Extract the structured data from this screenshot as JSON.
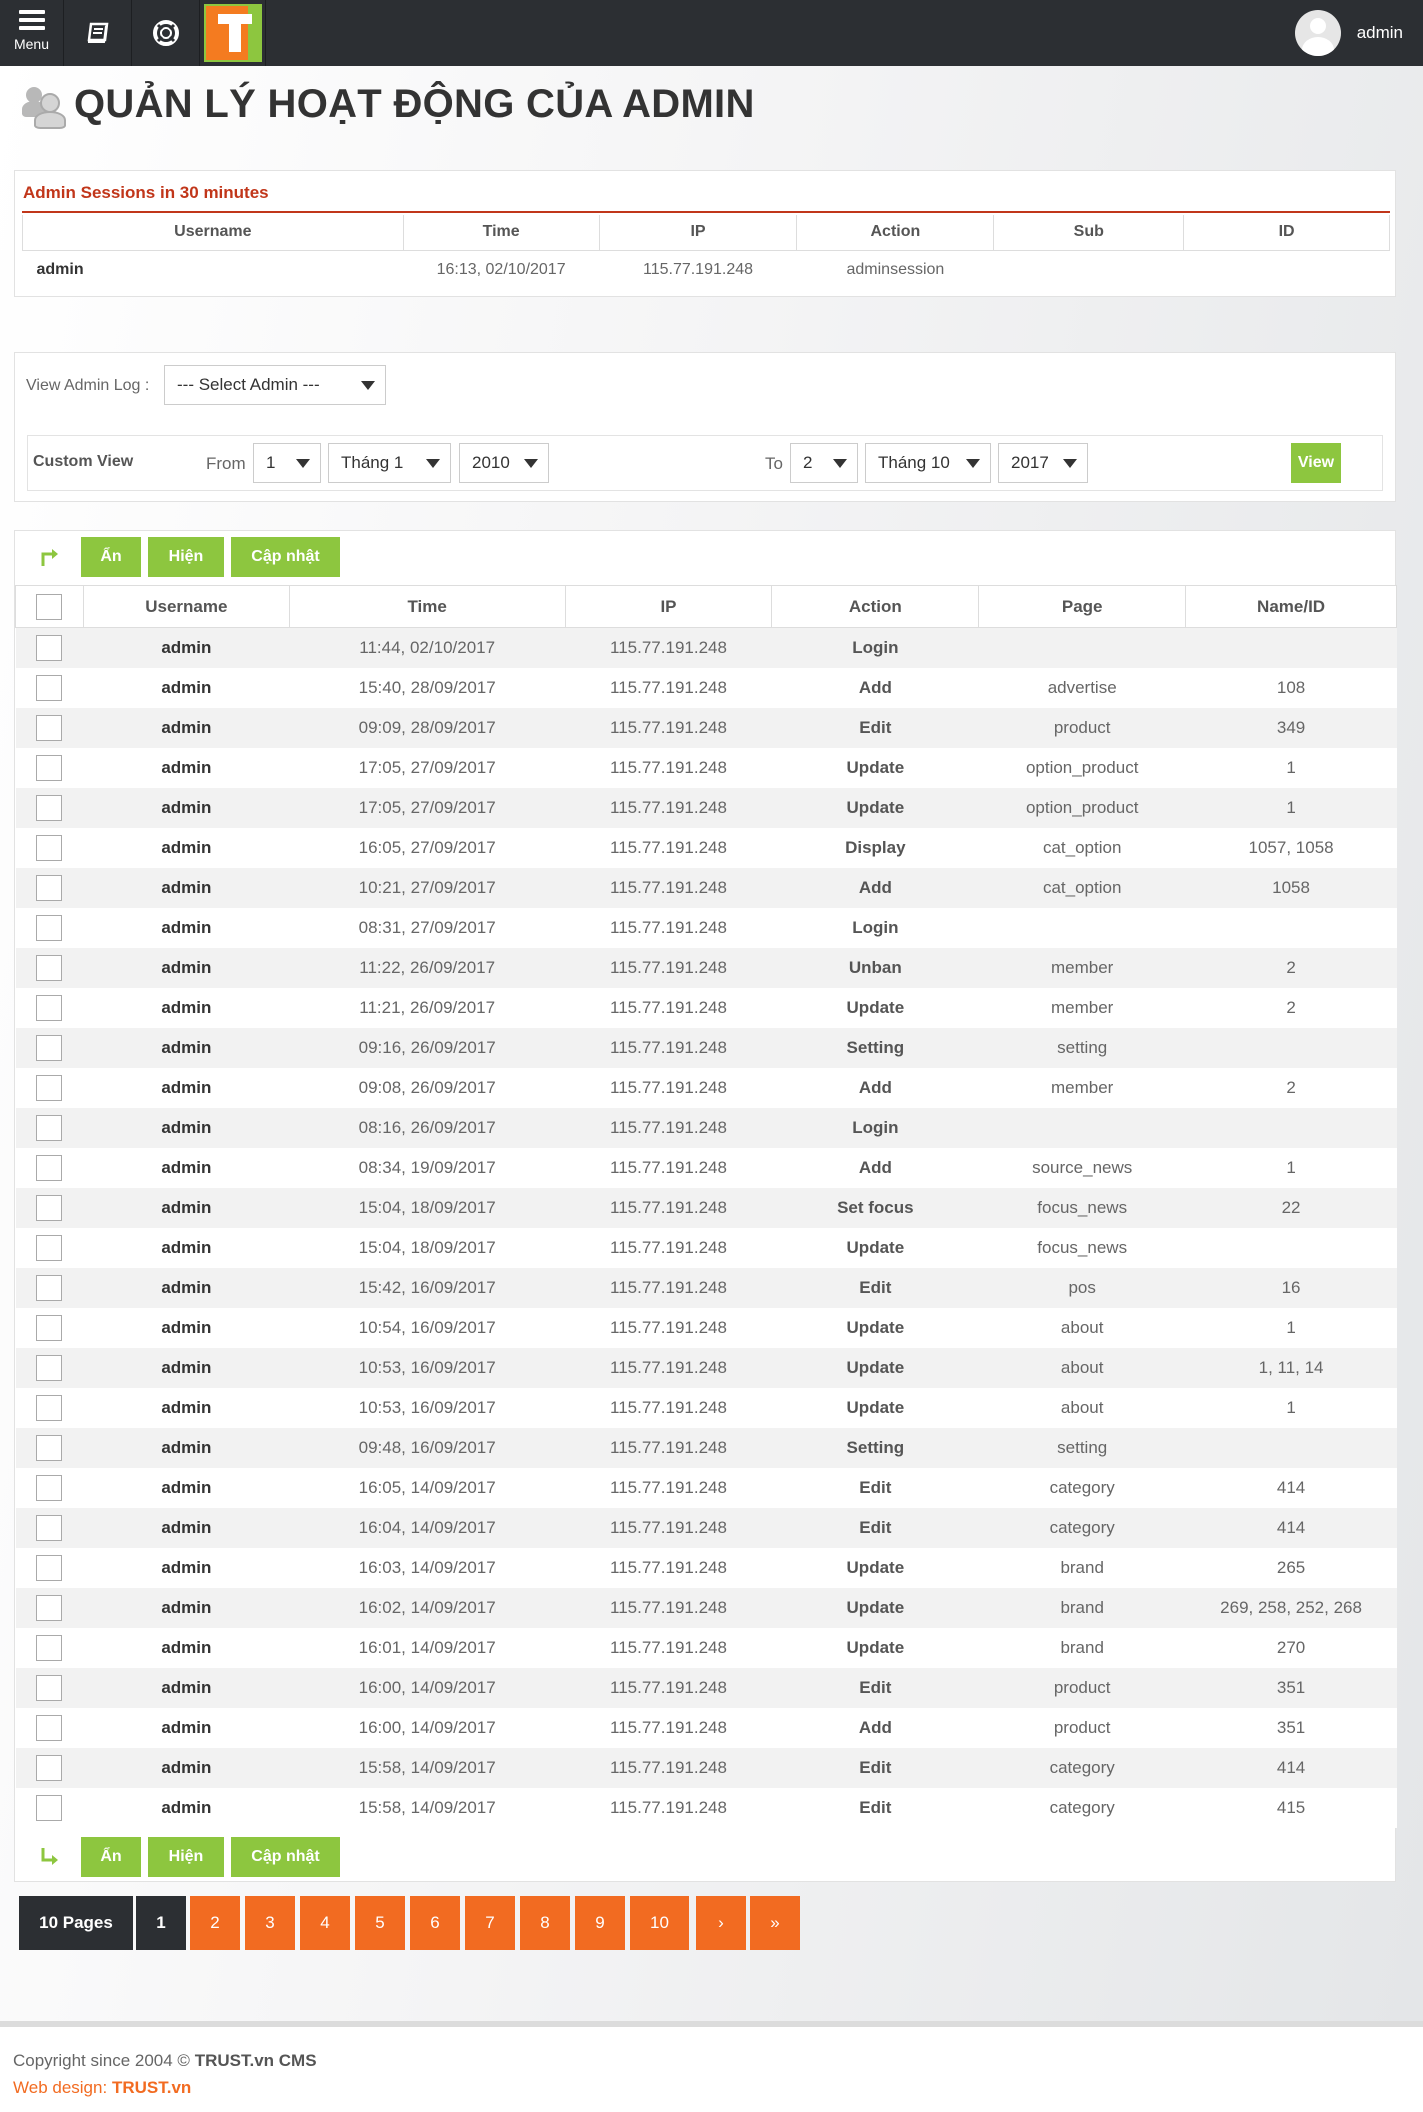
{
  "topbar": {
    "menu_label": "Menu",
    "user_name": "admin"
  },
  "page_title": "QUẢN LÝ HOẠT ĐỘNG CỦA ADMIN",
  "sessions": {
    "title": "Admin Sessions in 30 minutes",
    "headers": [
      "Username",
      "Time",
      "IP",
      "Action",
      "Sub",
      "ID"
    ],
    "rows": [
      {
        "username": "admin",
        "time": "16:13, 02/10/2017",
        "ip": "115.77.191.248",
        "action": "adminsession",
        "sub": "",
        "id": ""
      }
    ]
  },
  "filter": {
    "view_label": "View Admin Log :",
    "admin_select": "--- Select Admin ---",
    "custom_view_label": "Custom View",
    "from_label": "From",
    "from_day": "1",
    "from_month": "Tháng 1",
    "from_year": "2010",
    "to_label": "To",
    "to_day": "2",
    "to_month": "Tháng 10",
    "to_year": "2017",
    "view_button": "View"
  },
  "actions": {
    "hide": "Ẩn",
    "show": "Hiện",
    "update": "Cập nhật"
  },
  "log": {
    "headers": [
      "Username",
      "Time",
      "IP",
      "Action",
      "Page",
      "Name/ID"
    ],
    "rows": [
      {
        "username": "admin",
        "time": "11:44, 02/10/2017",
        "ip": "115.77.191.248",
        "action": "Login",
        "page": "",
        "nameid": ""
      },
      {
        "username": "admin",
        "time": "15:40, 28/09/2017",
        "ip": "115.77.191.248",
        "action": "Add",
        "page": "advertise",
        "nameid": "108"
      },
      {
        "username": "admin",
        "time": "09:09, 28/09/2017",
        "ip": "115.77.191.248",
        "action": "Edit",
        "page": "product",
        "nameid": "349"
      },
      {
        "username": "admin",
        "time": "17:05, 27/09/2017",
        "ip": "115.77.191.248",
        "action": "Update",
        "page": "option_product",
        "nameid": "1"
      },
      {
        "username": "admin",
        "time": "17:05, 27/09/2017",
        "ip": "115.77.191.248",
        "action": "Update",
        "page": "option_product",
        "nameid": "1"
      },
      {
        "username": "admin",
        "time": "16:05, 27/09/2017",
        "ip": "115.77.191.248",
        "action": "Display",
        "page": "cat_option",
        "nameid": "1057, 1058"
      },
      {
        "username": "admin",
        "time": "10:21, 27/09/2017",
        "ip": "115.77.191.248",
        "action": "Add",
        "page": "cat_option",
        "nameid": "1058"
      },
      {
        "username": "admin",
        "time": "08:31, 27/09/2017",
        "ip": "115.77.191.248",
        "action": "Login",
        "page": "",
        "nameid": ""
      },
      {
        "username": "admin",
        "time": "11:22, 26/09/2017",
        "ip": "115.77.191.248",
        "action": "Unban",
        "page": "member",
        "nameid": "2"
      },
      {
        "username": "admin",
        "time": "11:21, 26/09/2017",
        "ip": "115.77.191.248",
        "action": "Update",
        "page": "member",
        "nameid": "2"
      },
      {
        "username": "admin",
        "time": "09:16, 26/09/2017",
        "ip": "115.77.191.248",
        "action": "Setting",
        "page": "setting",
        "nameid": ""
      },
      {
        "username": "admin",
        "time": "09:08, 26/09/2017",
        "ip": "115.77.191.248",
        "action": "Add",
        "page": "member",
        "nameid": "2"
      },
      {
        "username": "admin",
        "time": "08:16, 26/09/2017",
        "ip": "115.77.191.248",
        "action": "Login",
        "page": "",
        "nameid": ""
      },
      {
        "username": "admin",
        "time": "08:34, 19/09/2017",
        "ip": "115.77.191.248",
        "action": "Add",
        "page": "source_news",
        "nameid": "1"
      },
      {
        "username": "admin",
        "time": "15:04, 18/09/2017",
        "ip": "115.77.191.248",
        "action": "Set focus",
        "page": "focus_news",
        "nameid": "22"
      },
      {
        "username": "admin",
        "time": "15:04, 18/09/2017",
        "ip": "115.77.191.248",
        "action": "Update",
        "page": "focus_news",
        "nameid": ""
      },
      {
        "username": "admin",
        "time": "15:42, 16/09/2017",
        "ip": "115.77.191.248",
        "action": "Edit",
        "page": "pos",
        "nameid": "16"
      },
      {
        "username": "admin",
        "time": "10:54, 16/09/2017",
        "ip": "115.77.191.248",
        "action": "Update",
        "page": "about",
        "nameid": "1"
      },
      {
        "username": "admin",
        "time": "10:53, 16/09/2017",
        "ip": "115.77.191.248",
        "action": "Update",
        "page": "about",
        "nameid": "1, 11, 14"
      },
      {
        "username": "admin",
        "time": "10:53, 16/09/2017",
        "ip": "115.77.191.248",
        "action": "Update",
        "page": "about",
        "nameid": "1"
      },
      {
        "username": "admin",
        "time": "09:48, 16/09/2017",
        "ip": "115.77.191.248",
        "action": "Setting",
        "page": "setting",
        "nameid": ""
      },
      {
        "username": "admin",
        "time": "16:05, 14/09/2017",
        "ip": "115.77.191.248",
        "action": "Edit",
        "page": "category",
        "nameid": "414"
      },
      {
        "username": "admin",
        "time": "16:04, 14/09/2017",
        "ip": "115.77.191.248",
        "action": "Edit",
        "page": "category",
        "nameid": "414"
      },
      {
        "username": "admin",
        "time": "16:03, 14/09/2017",
        "ip": "115.77.191.248",
        "action": "Update",
        "page": "brand",
        "nameid": "265"
      },
      {
        "username": "admin",
        "time": "16:02, 14/09/2017",
        "ip": "115.77.191.248",
        "action": "Update",
        "page": "brand",
        "nameid": "269, 258, 252, 268"
      },
      {
        "username": "admin",
        "time": "16:01, 14/09/2017",
        "ip": "115.77.191.248",
        "action": "Update",
        "page": "brand",
        "nameid": "270"
      },
      {
        "username": "admin",
        "time": "16:00, 14/09/2017",
        "ip": "115.77.191.248",
        "action": "Edit",
        "page": "product",
        "nameid": "351"
      },
      {
        "username": "admin",
        "time": "16:00, 14/09/2017",
        "ip": "115.77.191.248",
        "action": "Add",
        "page": "product",
        "nameid": "351"
      },
      {
        "username": "admin",
        "time": "15:58, 14/09/2017",
        "ip": "115.77.191.248",
        "action": "Edit",
        "page": "category",
        "nameid": "414"
      },
      {
        "username": "admin",
        "time": "15:58, 14/09/2017",
        "ip": "115.77.191.248",
        "action": "Edit",
        "page": "category",
        "nameid": "415"
      }
    ]
  },
  "pagination": {
    "pages_label": "10 Pages",
    "current": "1",
    "pages": [
      "2",
      "3",
      "4",
      "5",
      "6",
      "7",
      "8",
      "9",
      "10"
    ],
    "next": "›",
    "last": "»"
  },
  "footer": {
    "copyright_prefix": "Copyright since 2004 ©",
    "copyright_brand": "TRUST.vn CMS",
    "webdesign_prefix": "Web design:",
    "webdesign_brand": "TRUST.vn"
  },
  "colors": {
    "accent_green": "#8dc63f",
    "accent_orange": "#f26b21",
    "dark": "#2c2f33",
    "session_red": "#c1361a"
  }
}
